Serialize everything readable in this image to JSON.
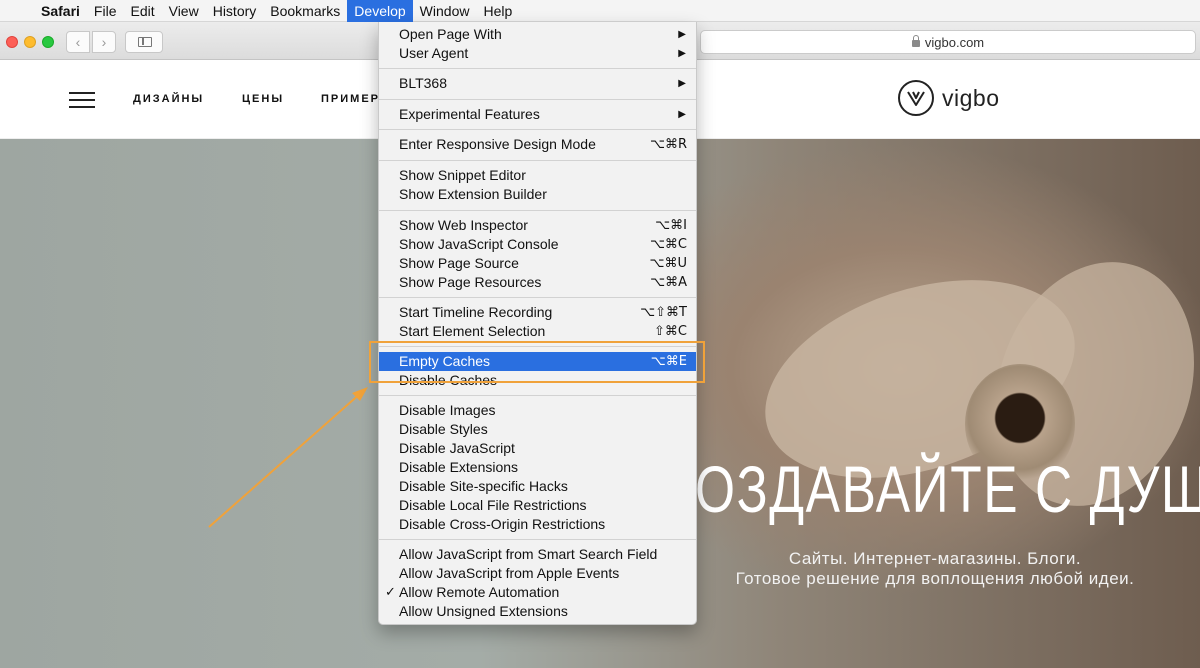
{
  "menubar": {
    "apple": "",
    "items": [
      "Safari",
      "File",
      "Edit",
      "View",
      "History",
      "Bookmarks",
      "Develop",
      "Window",
      "Help"
    ]
  },
  "browser": {
    "address": "vigbo.com",
    "back": "‹",
    "forward": "›"
  },
  "site": {
    "nav": [
      "ДИЗАЙНЫ",
      "ЦЕНЫ",
      "ПРИМЕР"
    ],
    "logo": "vigbo",
    "hero_title": "ОЗДАВАЙТЕ С ДУШО",
    "hero_sub_line1": "Сайты. Интернет-магазины. Блоги.",
    "hero_sub_line2": "Готовое решение для воплощения любой идеи."
  },
  "develop_menu": {
    "items": [
      {
        "label": "Open Page With",
        "submenu": "▶"
      },
      {
        "label": "User Agent",
        "submenu": "▶"
      },
      {
        "label": "BLT368",
        "submenu": "▶"
      },
      {
        "label": "Experimental Features",
        "submenu": "▶"
      },
      {
        "label": "Enter Responsive Design Mode",
        "shortcut": "⌥⌘R"
      },
      {
        "label": "Show Snippet Editor"
      },
      {
        "label": "Show Extension Builder"
      },
      {
        "label": "Show Web Inspector",
        "shortcut": "⌥⌘I"
      },
      {
        "label": "Show JavaScript Console",
        "shortcut": "⌥⌘C"
      },
      {
        "label": "Show Page Source",
        "shortcut": "⌥⌘U"
      },
      {
        "label": "Show Page Resources",
        "shortcut": "⌥⌘A"
      },
      {
        "label": "Start Timeline Recording",
        "shortcut": "⌥⇧⌘T"
      },
      {
        "label": "Start Element Selection",
        "shortcut": "⇧⌘C"
      },
      {
        "label": "Empty Caches",
        "shortcut": "⌥⌘E"
      },
      {
        "label": "Disable Caches"
      },
      {
        "label": "Disable Images"
      },
      {
        "label": "Disable Styles"
      },
      {
        "label": "Disable JavaScript"
      },
      {
        "label": "Disable Extensions"
      },
      {
        "label": "Disable Site-specific Hacks"
      },
      {
        "label": "Disable Local File Restrictions"
      },
      {
        "label": "Disable Cross-Origin Restrictions"
      },
      {
        "label": "Allow JavaScript from Smart Search Field"
      },
      {
        "label": "Allow JavaScript from Apple Events"
      },
      {
        "label": "Allow Remote Automation",
        "check": "✓"
      },
      {
        "label": "Allow Unsigned Extensions"
      }
    ]
  },
  "colors": {
    "highlight": "#2a6fe0",
    "callout": "#f0a23a"
  }
}
